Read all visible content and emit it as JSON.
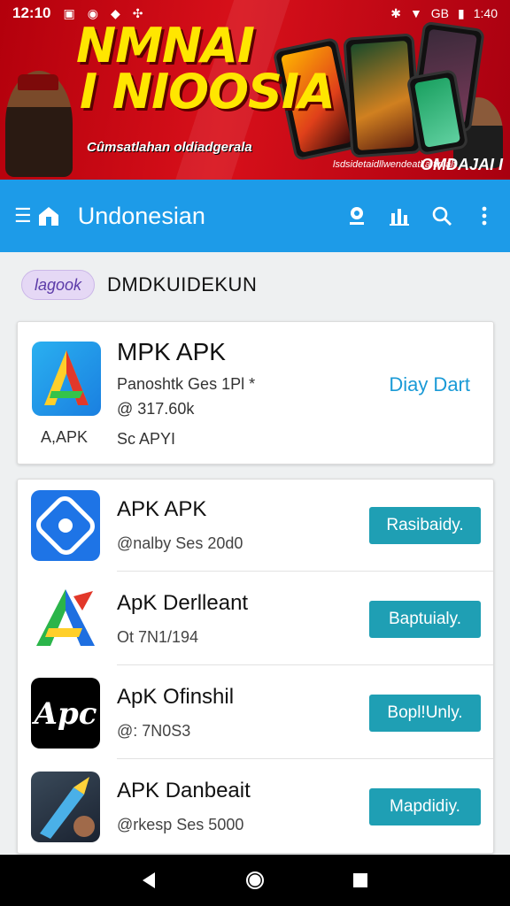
{
  "status_bar": {
    "time": "12:10",
    "carrier": "GB",
    "battery": "1:40"
  },
  "banner": {
    "title_line1": "NMNAI",
    "title_line2": "I NIOOSIA",
    "subtitle": "Cûmsatlahan oldiadgerala",
    "footer_text": "lsdsidetaidllwendeatl:a tinialt",
    "brand": "OMDAJAI I"
  },
  "toolbar": {
    "title": "Undonesian",
    "icons": [
      "menu-icon",
      "home-icon",
      "location-icon",
      "bar-chart-icon",
      "search-icon",
      "more-vert-icon"
    ]
  },
  "filter": {
    "chip_label": "lagook",
    "label": "DMDKUIDEKUN"
  },
  "featured": {
    "name": "MPK APK",
    "meta_line1": "Panoshtk Ges 1Pl *",
    "meta_line2": "@ 317.60k",
    "meta_line3": "Sc APYI",
    "icon_caption": "A,APK",
    "action_label": "Diay Dart",
    "icon": "a-letter-icon"
  },
  "apps": [
    {
      "name": "APK APK",
      "meta": "@nalby Ses 20d0",
      "button": "Rasibaidy.",
      "icon": "gamepad-icon"
    },
    {
      "name": "ApK Derlleant",
      "meta": "Ot 7N1/194",
      "button": "Baptuialy.",
      "icon": "a-triangle-icon"
    },
    {
      "name": "ApK Ofinshil",
      "meta": "@: 7N0S3",
      "button": "Bopl!Unly.",
      "icon": "apc-logo-icon"
    },
    {
      "name": "APK Danbeait",
      "meta": "@rkesp Ses 5000",
      "button": "Mapdidiy.",
      "icon": "game-art-icon"
    }
  ],
  "colors": {
    "banner_red": "#d8101a",
    "toolbar_blue": "#1d9be8",
    "button_teal": "#1f9fb4",
    "link_blue": "#1a9ad6"
  }
}
